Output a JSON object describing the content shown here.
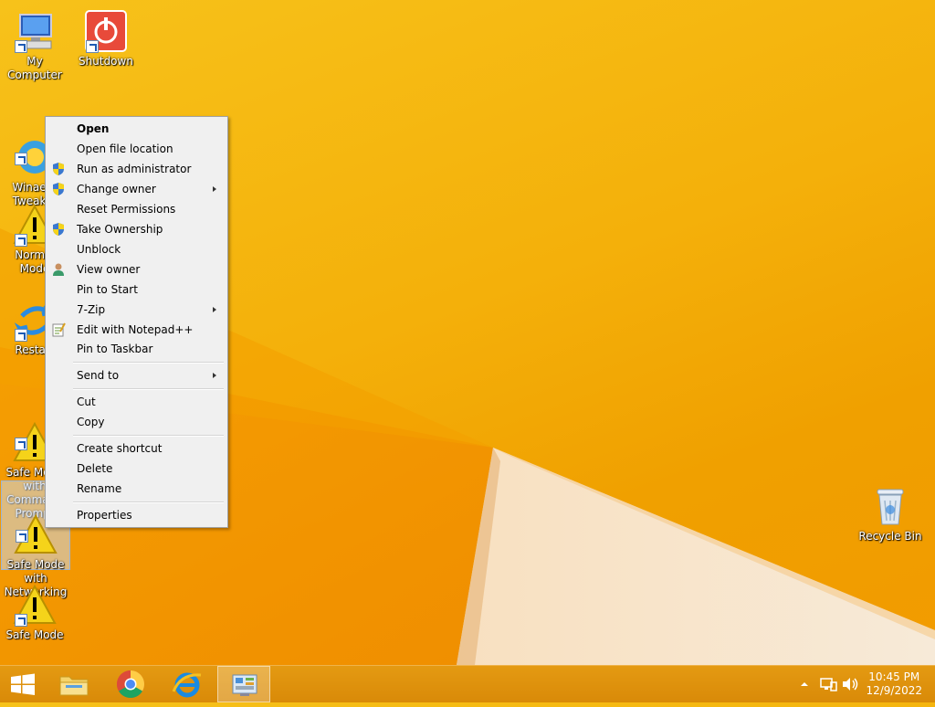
{
  "desktop_icons": [
    {
      "label": "My Computer"
    },
    {
      "label": "Shutdown"
    },
    {
      "label": "Winaero\nTweaker"
    },
    {
      "label": "Normal Mode"
    },
    {
      "label": "Restart"
    },
    {
      "label": "Safe Mode\nwith Command Prompt"
    },
    {
      "label": "Safe Mode\nwith\nNetworking"
    },
    {
      "label": "Safe Mode"
    },
    {
      "label": "Recycle Bin"
    }
  ],
  "context_menu": {
    "items": [
      {
        "label": "Open",
        "bold": true
      },
      {
        "label": "Open file location"
      },
      {
        "label": "Run as administrator",
        "icon": "uac-shield-icon"
      },
      {
        "label": "Change owner",
        "icon": "uac-shield-icon",
        "submenu": true
      },
      {
        "label": "Reset Permissions"
      },
      {
        "label": "Take Ownership",
        "icon": "uac-shield-icon"
      },
      {
        "label": "Unblock"
      },
      {
        "label": "View owner",
        "icon": "user-icon"
      },
      {
        "label": "Pin to Start"
      },
      {
        "label": "7-Zip",
        "submenu": true
      },
      {
        "label": "Edit with Notepad++",
        "icon": "notepad-icon"
      },
      {
        "label": "Pin to Taskbar"
      },
      {
        "label": "Send to",
        "submenu": true
      },
      {
        "label": "Cut"
      },
      {
        "label": "Copy"
      },
      {
        "label": "Create shortcut"
      },
      {
        "label": "Delete"
      },
      {
        "label": "Rename"
      },
      {
        "label": "Properties"
      }
    ]
  },
  "taskbar": {
    "clock_time": "10:45 PM",
    "clock_date": "12/9/2022"
  },
  "colors": {
    "wallpaper": "#f4b00a",
    "taskbar": "#de9210",
    "menu_bg": "#f0f0f0"
  }
}
